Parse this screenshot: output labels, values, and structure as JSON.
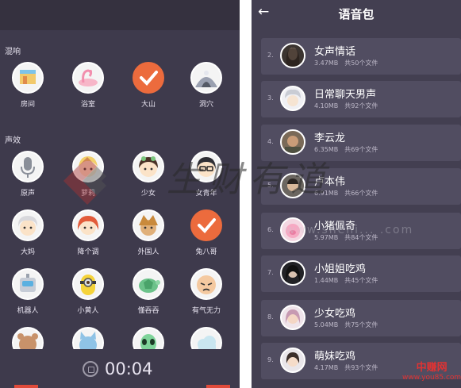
{
  "left": {
    "reverb_label": "混响",
    "effects_label": "声效",
    "reverb_items": [
      {
        "label": "房间",
        "icon": "room-icon",
        "selected": false
      },
      {
        "label": "浴室",
        "icon": "bathtub-icon",
        "selected": false
      },
      {
        "label": "大山",
        "icon": "checkmark-icon",
        "selected": true
      },
      {
        "label": "洞穴",
        "icon": "cave-icon",
        "selected": false
      }
    ],
    "effect_items": [
      {
        "label": "原声",
        "icon": "microphone-icon",
        "selected": false
      },
      {
        "label": "萝莉",
        "icon": "loli-icon",
        "selected": false
      },
      {
        "label": "少女",
        "icon": "girl-icon",
        "selected": false
      },
      {
        "label": "女青年",
        "icon": "young-woman-icon",
        "selected": false
      },
      {
        "label": "大妈",
        "icon": "aunt-icon",
        "selected": false
      },
      {
        "label": "降个调",
        "icon": "lower-pitch-icon",
        "selected": false
      },
      {
        "label": "外国人",
        "icon": "foreigner-icon",
        "selected": false
      },
      {
        "label": "兔八哥",
        "icon": "checkmark-icon",
        "selected": true
      },
      {
        "label": "机器人",
        "icon": "robot-icon",
        "selected": false
      },
      {
        "label": "小黄人",
        "icon": "minion-icon",
        "selected": false
      },
      {
        "label": "懂吞吞",
        "icon": "turtle-icon",
        "selected": false
      },
      {
        "label": "有气无力",
        "icon": "weak-face-icon",
        "selected": false
      },
      {
        "label": "",
        "icon": "bear-icon",
        "selected": false
      },
      {
        "label": "",
        "icon": "cat-icon",
        "selected": false
      },
      {
        "label": "",
        "icon": "alien-icon",
        "selected": false
      },
      {
        "label": "",
        "icon": "cloud-icon",
        "selected": false
      }
    ],
    "timer": "00:04"
  },
  "right": {
    "title": "语音包",
    "back_icon": "back-arrow-icon",
    "items": [
      {
        "index": "2.",
        "name": "女声情话",
        "size": "3.47MB",
        "count": "共50个文件"
      },
      {
        "index": "3.",
        "name": "日常聊天男声",
        "size": "4.10MB",
        "count": "共92个文件"
      },
      {
        "index": "4.",
        "name": "李云龙",
        "size": "6.35MB",
        "count": "共69个文件"
      },
      {
        "index": "5.",
        "name": "卢本伟",
        "size": "6.91MB",
        "count": "共66个文件"
      },
      {
        "index": "6.",
        "name": "小猪佩奇",
        "size": "5.97MB",
        "count": "共84个文件"
      },
      {
        "index": "7.",
        "name": "小姐姐吃鸡",
        "size": "1.44MB",
        "count": "共45个文件"
      },
      {
        "index": "8.",
        "name": "少女吃鸡",
        "size": "5.04MB",
        "count": "共75个文件"
      },
      {
        "index": "9.",
        "name": "萌妹吃鸡",
        "size": "4.17MB",
        "count": "共93个文件"
      }
    ]
  },
  "watermark": {
    "main_text": "生财有道",
    "url": "www.sheni...  .com",
    "corner_title": "中赚网",
    "corner_url": "www.you85.com"
  },
  "colors": {
    "panel_bg": "#3e3a4c",
    "row_bg": "#514d61",
    "accent": "#ec6b3d",
    "text": "#e8e4f0"
  }
}
